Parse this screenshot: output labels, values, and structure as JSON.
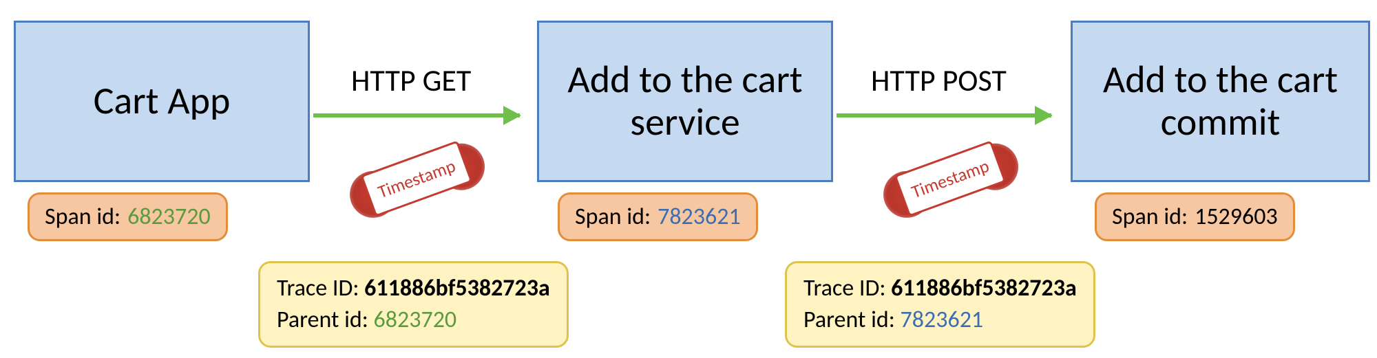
{
  "services": [
    {
      "title": "Cart App"
    },
    {
      "title": "Add to the cart service"
    },
    {
      "title": "Add to the cart commit"
    }
  ],
  "spans": [
    {
      "label": "Span id:",
      "value": "6823720",
      "color": "c-green"
    },
    {
      "label": "Span id:",
      "value": "7823621",
      "color": "c-blue"
    },
    {
      "label": "Span id:",
      "value": "1529603",
      "color": "c-black"
    }
  ],
  "calls": [
    {
      "method": "HTTP GET",
      "trace_label": "Trace ID:",
      "trace_id": "611886bf5382723a",
      "parent_label": "Parent id:",
      "parent_id": "6823720",
      "parent_color": "c-green",
      "stamp_text": "Timestamp"
    },
    {
      "method": "HTTP POST",
      "trace_label": "Trace ID:",
      "trace_id": "611886bf5382723a",
      "parent_label": "Parent id:",
      "parent_id": "7823621",
      "parent_color": "c-blue",
      "stamp_text": "Timestamp"
    }
  ]
}
